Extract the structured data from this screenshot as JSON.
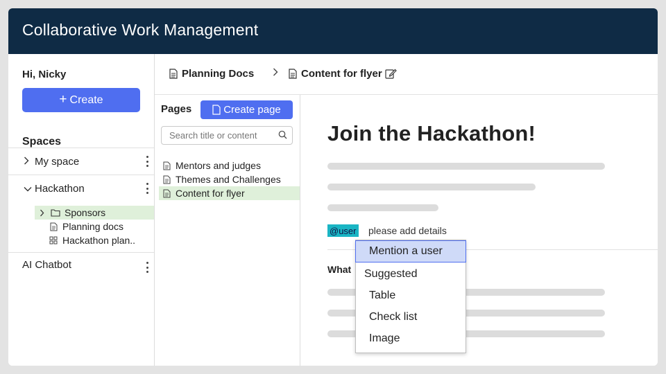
{
  "app": {
    "title": "Collaborative Work Management"
  },
  "sidebar": {
    "greeting": "Hi, Nicky",
    "create_label": "Create",
    "spaces_heading": "Spaces",
    "my_space": "My space",
    "hackathon": "Hackathon",
    "tree": [
      {
        "label": "Sponsors",
        "icon": "folder-icon",
        "active": true
      },
      {
        "label": "Planning docs",
        "icon": "document-icon"
      },
      {
        "label": "Hackathon plan..",
        "icon": "board-icon"
      }
    ],
    "ai_chatbot": "AI Chatbot"
  },
  "breadcrumb": {
    "parent": "Planning Docs",
    "current": "Content for flyer"
  },
  "pages": {
    "heading": "Pages",
    "create_page_label": "Create page",
    "search_placeholder": "Search title or content",
    "items": [
      {
        "label": "Mentors and judges"
      },
      {
        "label": "Themes and Challenges"
      },
      {
        "label": "Content for flyer",
        "active": true
      }
    ]
  },
  "editor": {
    "title": "Join the Hackathon!",
    "mention_tag": "@user",
    "mention_text": "please add details",
    "section_label": "What"
  },
  "mention_menu": {
    "items": [
      "Mention a user",
      "Suggested",
      "Table",
      "Check list",
      "Image"
    ],
    "highlighted": "Mention a user"
  },
  "colors": {
    "header_bg": "#0f2b45",
    "accent": "#4f6ef0",
    "active_row": "#dff0da",
    "mention_tag": "#1ab5c4"
  }
}
